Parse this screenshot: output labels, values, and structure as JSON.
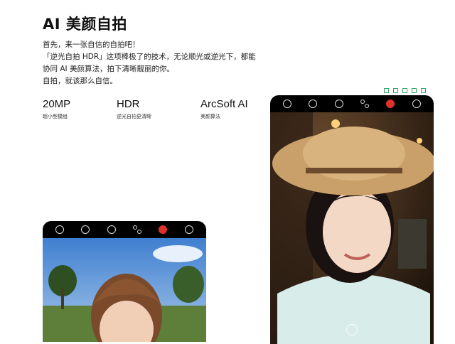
{
  "header": {
    "title": "AI 美颜自拍"
  },
  "description": {
    "lines": [
      "首先，来一张自信的自拍吧！",
      "「逆光自拍 HDR」这项棒极了的技术，无论顺光或逆光下，都能",
      "协同 AI 美颜算法，拍下清晰靓丽的你。",
      "自拍，就该那么自信。"
    ]
  },
  "specs": [
    {
      "value": "20MP",
      "caption": "超小型模组"
    },
    {
      "value": "HDR",
      "caption": "逆光自拍更清晰"
    },
    {
      "value": "ArcSoft AI",
      "caption": "美颜算法"
    }
  ],
  "camera_toolbar": {
    "icons": [
      "flash-icon",
      "hdr-icon",
      "timer-icon",
      "beauty-filter-icon",
      "ai-beauty-icon",
      "settings-icon"
    ]
  },
  "colors": {
    "accent": "#e0302a",
    "share_icon": "#3aa36a"
  }
}
